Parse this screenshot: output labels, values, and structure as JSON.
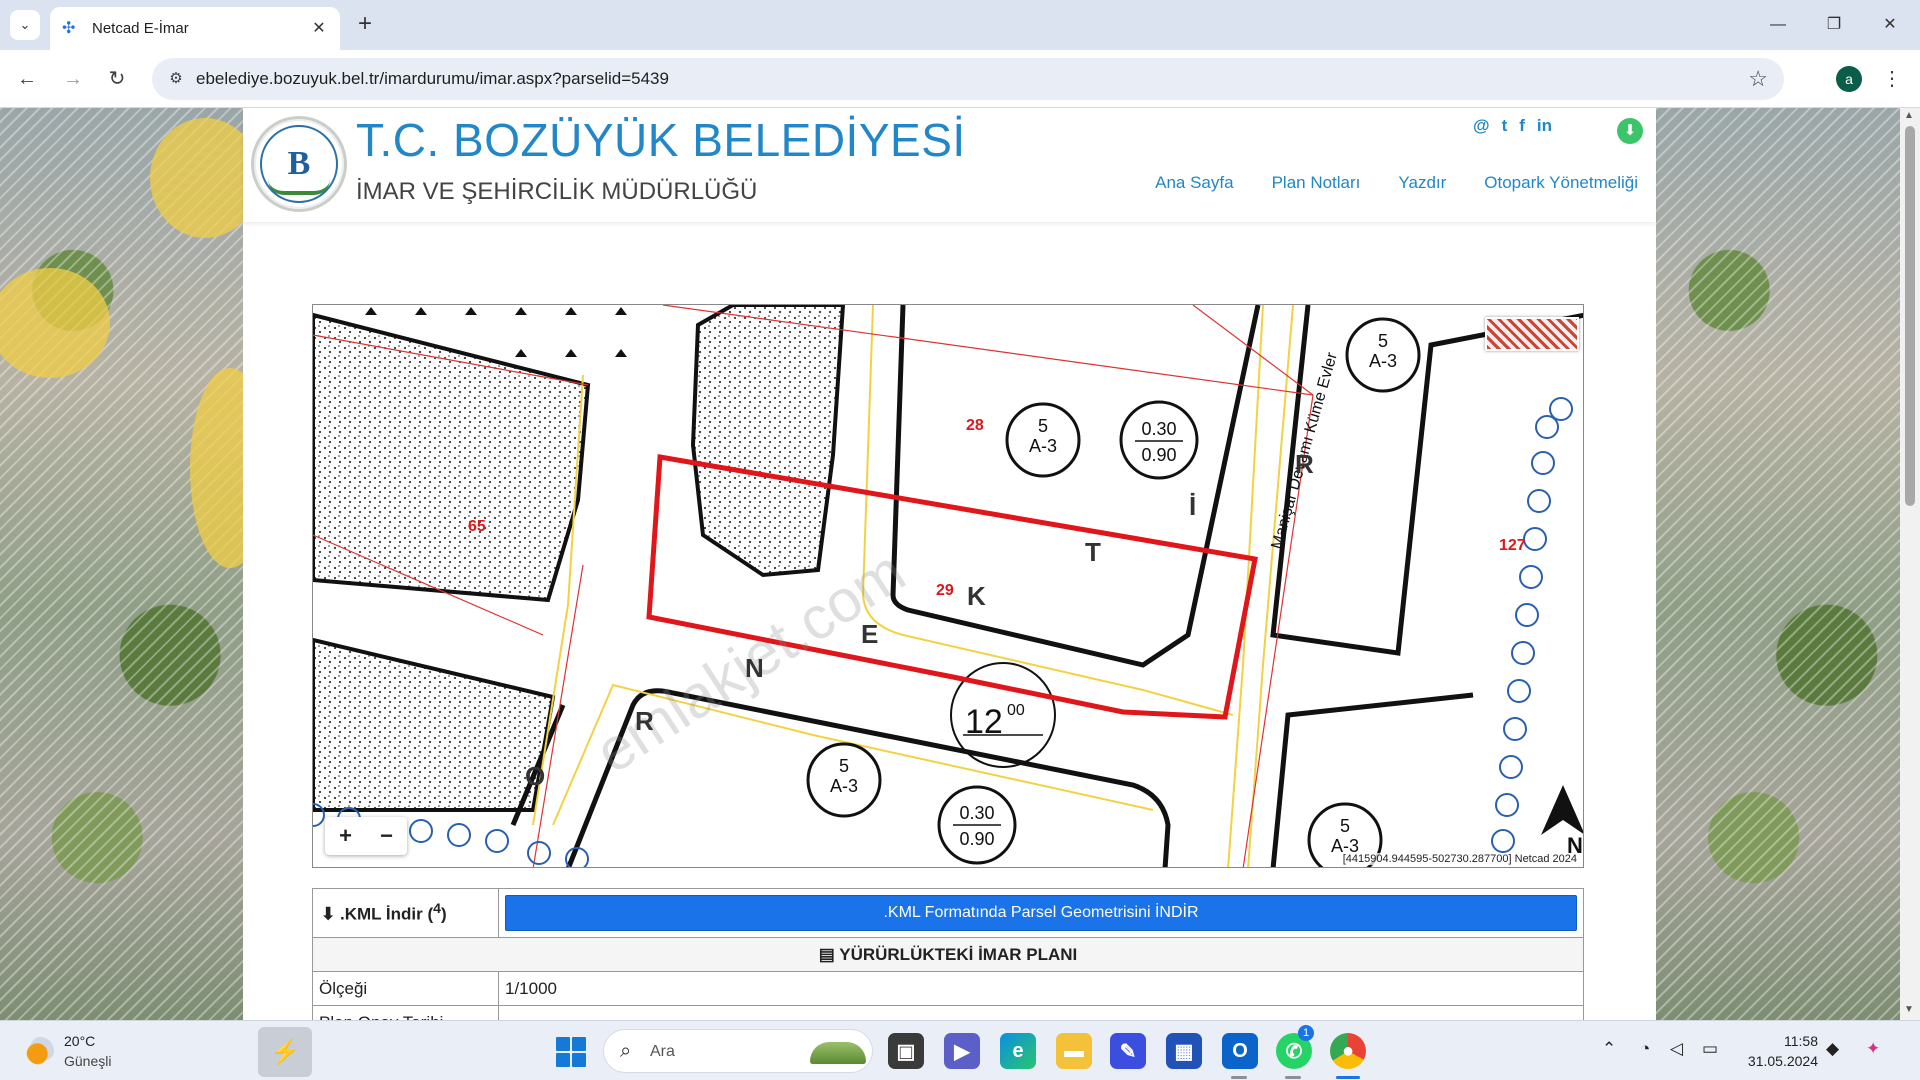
{
  "browser": {
    "tab_title": "Netcad E-İmar",
    "url": "ebelediye.bozuyuk.bel.tr/imardurumu/imar.aspx?parselid=5439",
    "profile_initial": "a"
  },
  "header": {
    "title": "T.C. BOZÜYÜK BELEDİYESİ",
    "subtitle": "İMAR VE ŞEHİRCİLİK MÜDÜRLÜĞÜ",
    "social": [
      "@",
      "t",
      "f",
      "in"
    ],
    "nav": [
      {
        "label": "Ana Sayfa"
      },
      {
        "label": "Plan Notları"
      },
      {
        "label": "Yazdır"
      },
      {
        "label": "Otopark Yönetmeliği"
      }
    ]
  },
  "map": {
    "parcel_numbers": [
      "28",
      "29",
      "65",
      "127"
    ],
    "street_label": "Manişar Devamı Küme Evler",
    "zone_codes": [
      "A-3",
      "A-3",
      "A-3",
      "A-3",
      "A-3"
    ],
    "zone_floors": [
      "5",
      "5",
      "5",
      "5",
      "5"
    ],
    "ratio_top": [
      "0.30",
      "0.30"
    ],
    "ratio_bottom": [
      "0.90",
      "0.90"
    ],
    "road_width": "12",
    "road_width_suffix": "00",
    "road_letters": [
      "R",
      "N",
      "E",
      "K",
      "T",
      "İ",
      "R",
      "O"
    ],
    "watermark": "emlakjet.com",
    "north_label": "N",
    "coords": "[4415904.944595-502730.287700] Netcad 2024",
    "zoom_in": "+",
    "zoom_out": "−"
  },
  "info": {
    "kml_label": ".KML İndir (",
    "kml_sup": "4",
    "kml_label_end": ")",
    "kml_button": ".KML Formatında Parsel Geometrisini İNDİR",
    "plan_header": "YÜRÜRLÜKTEKİ İMAR PLANI",
    "scale_label": "Ölçeği",
    "scale_value": "1/1000",
    "next_label": "Plan Onay Tarihi"
  },
  "taskbar": {
    "temperature": "20°C",
    "weather": "Güneşli",
    "search_placeholder": "Ara",
    "whatsapp_badge": "1",
    "time": "11:58",
    "date": "31.05.2024"
  },
  "colors": {
    "brand_blue": "#2187c8",
    "parcel_red": "#e0161a",
    "button_blue": "#1a73e8"
  }
}
